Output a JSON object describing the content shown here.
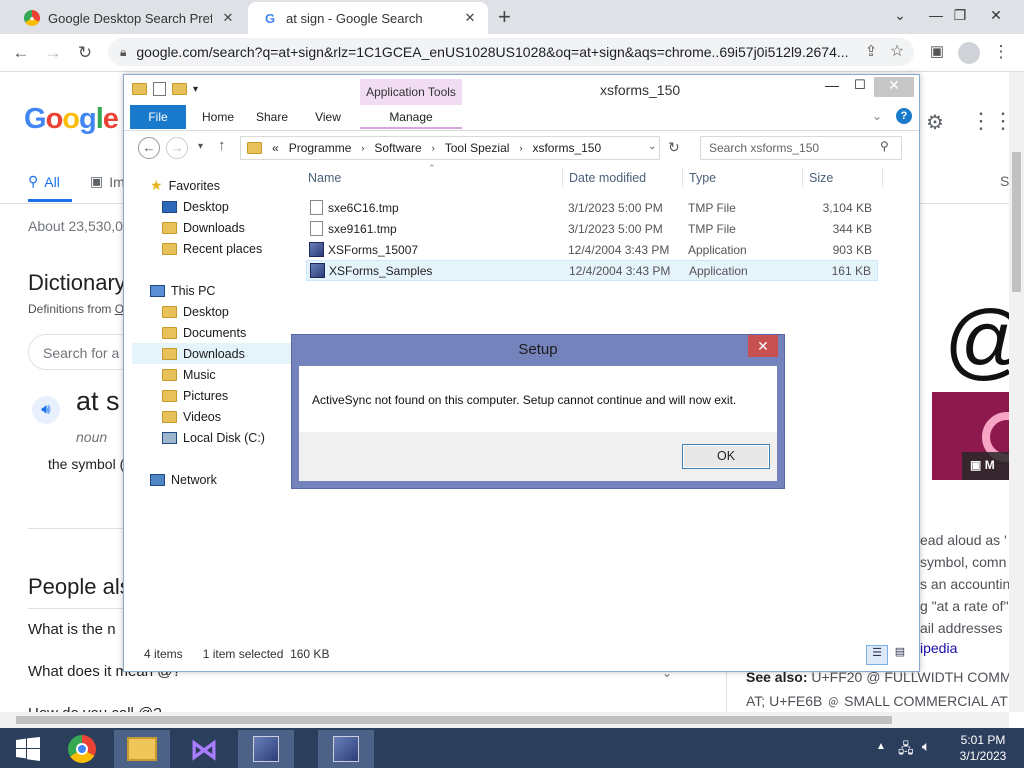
{
  "browser": {
    "tabs": [
      {
        "title": "Google Desktop Search Preferen",
        "icon": "chrome-favicon"
      },
      {
        "title": "at sign - Google Search",
        "icon": "google-favicon"
      }
    ],
    "url": "google.com/search?q=at+sign&rlz=1C1GCEA_enUS1028US1028&oq=at+sign&aqs=chrome..69i57j0i512l9.2674..."
  },
  "google": {
    "logo": "Google",
    "tabs": [
      "All",
      "Im"
    ],
    "tab_right_stub": "S",
    "results_count": "About 23,530,0",
    "dictionary_heading": "Dictionary",
    "definitions_from": "Definitions from",
    "definitions_link": "O",
    "search_placeholder": "Search for a",
    "word": "at s",
    "pos": "noun",
    "definition": "the symbol (",
    "people_also": "People als",
    "paa_q1": "What is the n",
    "paa_q2": "What does it mean @?",
    "paa_q3": "How do you call @?",
    "kp_lines": [
      "ead aloud as '",
      "symbol, comn",
      "s an accountin",
      "g \"at a rate of\"",
      "ail addresses"
    ],
    "kp_link": "ipedia",
    "see_also_label": "See also:",
    "see_also_text": "U+FF20 @ FULLWIDTH COMM",
    "see_also_text2": "AT; U+FE6B ﹫ SMALL COMMERCIAL AT",
    "at_symbol": "@",
    "more_images": "M"
  },
  "explorer": {
    "title": "xsforms_150",
    "context_tab": "Application Tools",
    "ribbon_tabs": [
      "File",
      "Home",
      "Share",
      "View",
      "Manage"
    ],
    "breadcrumb": [
      "«",
      "Programme",
      "Software",
      "Tool Spezial",
      "xsforms_150"
    ],
    "search_placeholder": "Search xsforms_150",
    "nav": {
      "favorites": "Favorites",
      "fav_items": [
        "Desktop",
        "Downloads",
        "Recent places"
      ],
      "this_pc": "This PC",
      "pc_items": [
        "Desktop",
        "Documents",
        "Downloads",
        "Music",
        "Pictures",
        "Videos",
        "Local Disk (C:)"
      ],
      "network": "Network"
    },
    "columns": [
      "Name",
      "Date modified",
      "Type",
      "Size"
    ],
    "files": [
      {
        "name": "sxe6C16.tmp",
        "date": "3/1/2023 5:00 PM",
        "type": "TMP File",
        "size": "3,104 KB",
        "icon": "file-icon"
      },
      {
        "name": "sxe9161.tmp",
        "date": "3/1/2023 5:00 PM",
        "type": "TMP File",
        "size": "344 KB",
        "icon": "file-icon"
      },
      {
        "name": "XSForms_15007",
        "date": "12/4/2004 3:43 PM",
        "type": "Application",
        "size": "903 KB",
        "icon": "app-icon"
      },
      {
        "name": "XSForms_Samples",
        "date": "12/4/2004 3:43 PM",
        "type": "Application",
        "size": "161 KB",
        "icon": "app-icon",
        "selected": true
      }
    ],
    "status_items": "4 items",
    "status_selected": "1 item selected",
    "status_size": "160 KB"
  },
  "dialog": {
    "title": "Setup",
    "message": "ActiveSync not found on this computer. Setup cannot continue and will now exit.",
    "ok": "OK"
  },
  "taskbar": {
    "time": "5:01 PM",
    "date": "3/1/2023",
    "apps": [
      "chrome-icon",
      "file-explorer-icon",
      "visual-studio-icon",
      "setup-app-icon",
      "setup-app-icon"
    ]
  },
  "colors": {
    "taskbar": "#2b3e5c",
    "dialog_frame": "#7583bd",
    "google_blue": "#4285f4",
    "selection": "#e5f3fb"
  }
}
